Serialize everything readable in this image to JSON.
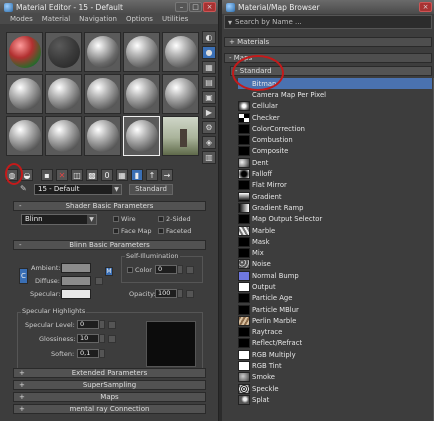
{
  "material_editor": {
    "title": "Material Editor - 15 - Default",
    "menu": [
      "Modes",
      "Material",
      "Navigation",
      "Options",
      "Utilities"
    ],
    "material_name": "15 - Default",
    "material_type": "Standard",
    "shader_params": {
      "header": "Shader Basic Parameters",
      "shader": "Blinn",
      "wire": "Wire",
      "two_sided": "2-Sided",
      "face_map": "Face Map",
      "faceted": "Faceted"
    },
    "blinn_params": {
      "header": "Blinn Basic Parameters",
      "ambient": "Ambient:",
      "diffuse": "Diffuse:",
      "specular": "Specular:",
      "self_illum": "Self-Illumination",
      "color_label": "Color",
      "color_value": "0",
      "opacity_label": "Opacity:",
      "opacity_value": "100",
      "lock_label": "C",
      "link_label": "M"
    },
    "spec_highlights": {
      "header": "Specular Highlights",
      "level_label": "Specular Level:",
      "level_value": "0",
      "gloss_label": "Glossiness:",
      "gloss_value": "10",
      "soften_label": "Soften:",
      "soften_value": "0,1"
    },
    "rollouts": [
      "Extended Parameters",
      "SuperSampling",
      "Maps",
      "mental ray Connection"
    ]
  },
  "browser": {
    "title": "Material/Map Browser",
    "search_placeholder": "Search by Name ...",
    "materials_header": "+ Materials",
    "maps_header": "- Maps",
    "standard_header": "- Standard",
    "maps": [
      "Bitmap",
      "Camera Map Per Pixel",
      "Cellular",
      "Checker",
      "ColorCorrection",
      "Combustion",
      "Composite",
      "Dent",
      "Falloff",
      "Flat Mirror",
      "Gradient",
      "Gradient Ramp",
      "Map Output Selector",
      "Marble",
      "Mask",
      "Mix",
      "Noise",
      "Normal Bump",
      "Output",
      "Particle Age",
      "Particle MBlur",
      "Perlin Marble",
      "Raytrace",
      "Reflect/Refract",
      "RGB Multiply",
      "RGB Tint",
      "Smoke",
      "Speckle",
      "Splat"
    ]
  }
}
